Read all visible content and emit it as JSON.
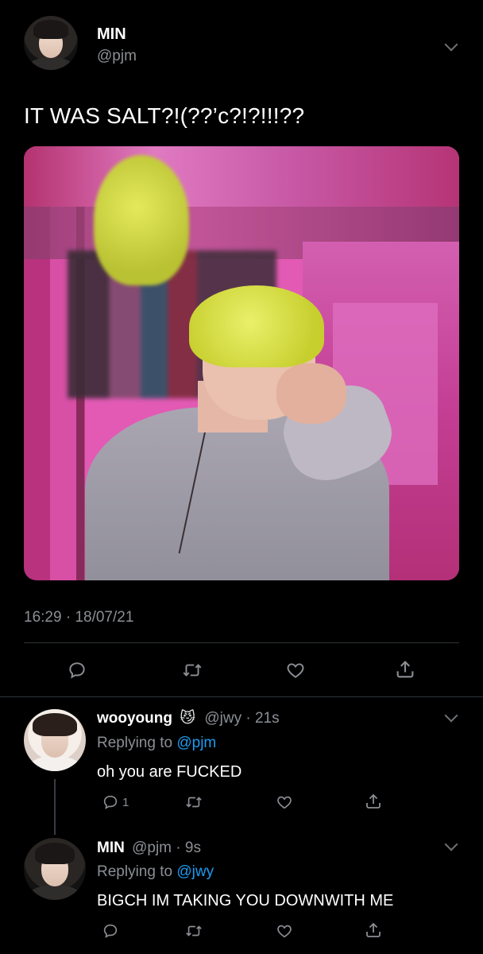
{
  "main_tweet": {
    "name": "MIN",
    "handle": "@pjm",
    "text": "IT WAS SALT?!(??’c?!?!!!??",
    "timestamp": "16:29 · 18/07/21"
  },
  "reply1": {
    "name": "wooyoung",
    "emoji": "😼",
    "handle": "@jwy",
    "time": "· 21s",
    "replying_prefix": "Replying to",
    "replying_handle": "@pjm",
    "text": "oh you are FUCKED",
    "reply_count": "1"
  },
  "reply2": {
    "name": "MIN",
    "handle": "@pjm",
    "time": "· 9s",
    "replying_prefix": "Replying to",
    "replying_handle": "@jwy",
    "text": "BIGCH IM TAKING YOU DOWNWITH ME"
  },
  "icons": [
    "reply-icon",
    "retweet-icon",
    "like-icon",
    "share-icon",
    "chevron-down-icon"
  ]
}
